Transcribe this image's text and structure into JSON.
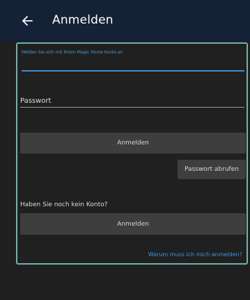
{
  "appbar": {
    "title": "Anmelden",
    "back_icon": "arrow-left-icon"
  },
  "form": {
    "email_label": "Melden Sie sich mit Ihrem Magic Home Konto an",
    "email_value": "",
    "password_placeholder": "Passwort",
    "login_button": "Anmelden",
    "retrieve_password_button": "Passwort abrufen"
  },
  "register": {
    "question": "Haben Sie noch kein Konto?",
    "login_button": "Anmelden",
    "why_link": "Warum muss ich mich anmelden?"
  },
  "colors": {
    "appbar_bg": "#152136",
    "accent_blue": "#3b8fd6",
    "frame_border": "#72b2ad",
    "button_bg": "#3e3e3e",
    "background": "#1f1f1f"
  }
}
